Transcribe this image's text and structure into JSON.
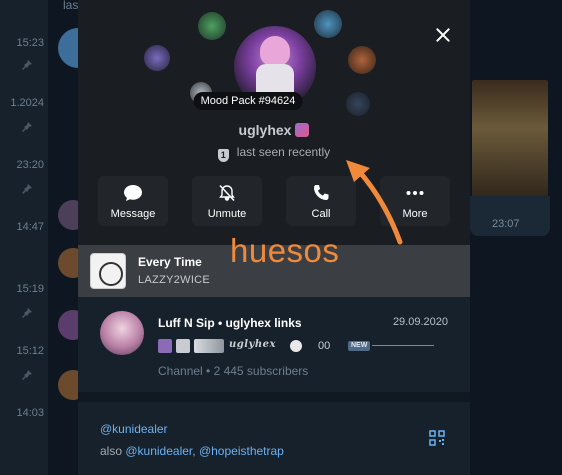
{
  "background": {
    "preview_text": "last seen recently",
    "times": [
      "15:23",
      "1.2024",
      "23:20",
      "14:47",
      "15:19",
      "15:12",
      "14:03"
    ],
    "message_time": "23:07"
  },
  "profile": {
    "mood_badge": "Mood Pack #94624",
    "name": "uglyhex",
    "status": "last seen recently",
    "shield_glyph": "1"
  },
  "actions": [
    {
      "label": "Message",
      "icon": "message-bubble-icon"
    },
    {
      "label": "Unmute",
      "icon": "bell-off-icon"
    },
    {
      "label": "Call",
      "icon": "phone-icon"
    },
    {
      "label": "More",
      "icon": "more-dots-icon"
    }
  ],
  "song": {
    "title": "Every Time",
    "artist": "LAZZY2WICE"
  },
  "channel": {
    "name": "Luff N Sip • uglyhex links",
    "date": "29.09.2020",
    "handle": "uglyhex",
    "count": "00",
    "new_badge": "NEW",
    "subtitle": "Channel • 2 445 subscribers"
  },
  "links": {
    "username": "@kunidealer",
    "also_prefix": "also",
    "also_1": "@kunidealer",
    "separator": ",",
    "also_2": "@hopeisthetrap"
  },
  "annotation": {
    "text": "huesos",
    "color": "#f08a3a"
  },
  "colors": {
    "accent_link": "#6ab2f2",
    "panel": "#17212b",
    "hero": "#1a1d22"
  }
}
